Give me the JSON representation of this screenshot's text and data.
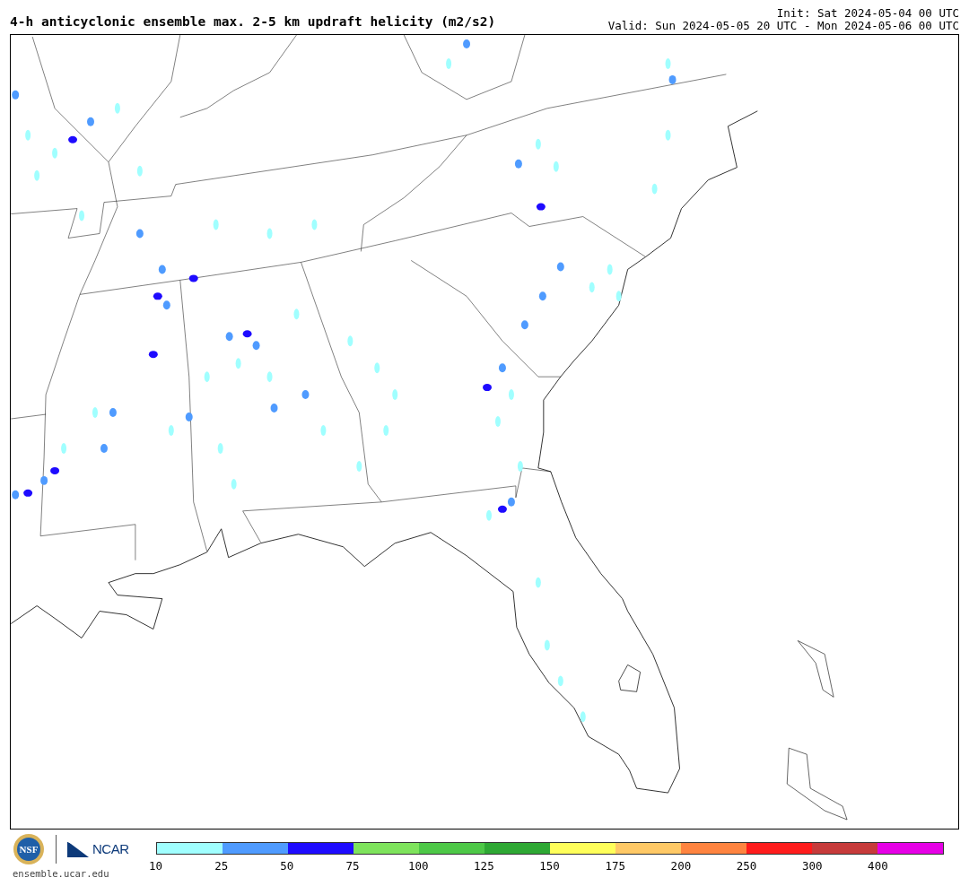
{
  "title": "4-h anticyclonic ensemble max. 2-5 km updraft helicity (m2/s2)",
  "init": "Init: Sat 2024-05-04 00 UTC",
  "valid": "Valid: Sun 2024-05-05 20 UTC - Mon 2024-05-06 00 UTC",
  "logos": {
    "nsf": "NSF",
    "ncar": "NCAR",
    "site": "ensemble.ucar.edu"
  },
  "colorbar": {
    "segments": [
      {
        "color": "#a0ffff"
      },
      {
        "color": "#4f9bff"
      },
      {
        "color": "#1e0bff"
      },
      {
        "color": "#7ee35c"
      },
      {
        "color": "#4dc847"
      },
      {
        "color": "#2ea834"
      },
      {
        "color": "#ffff5a"
      },
      {
        "color": "#ffc966"
      },
      {
        "color": "#ff8440"
      },
      {
        "color": "#ff1c1c"
      },
      {
        "color": "#c73b3b"
      },
      {
        "color": "#e600e6"
      }
    ],
    "ticks": [
      "10",
      "25",
      "50",
      "75",
      "100",
      "125",
      "150",
      "175",
      "200",
      "250",
      "300",
      "400"
    ]
  }
}
